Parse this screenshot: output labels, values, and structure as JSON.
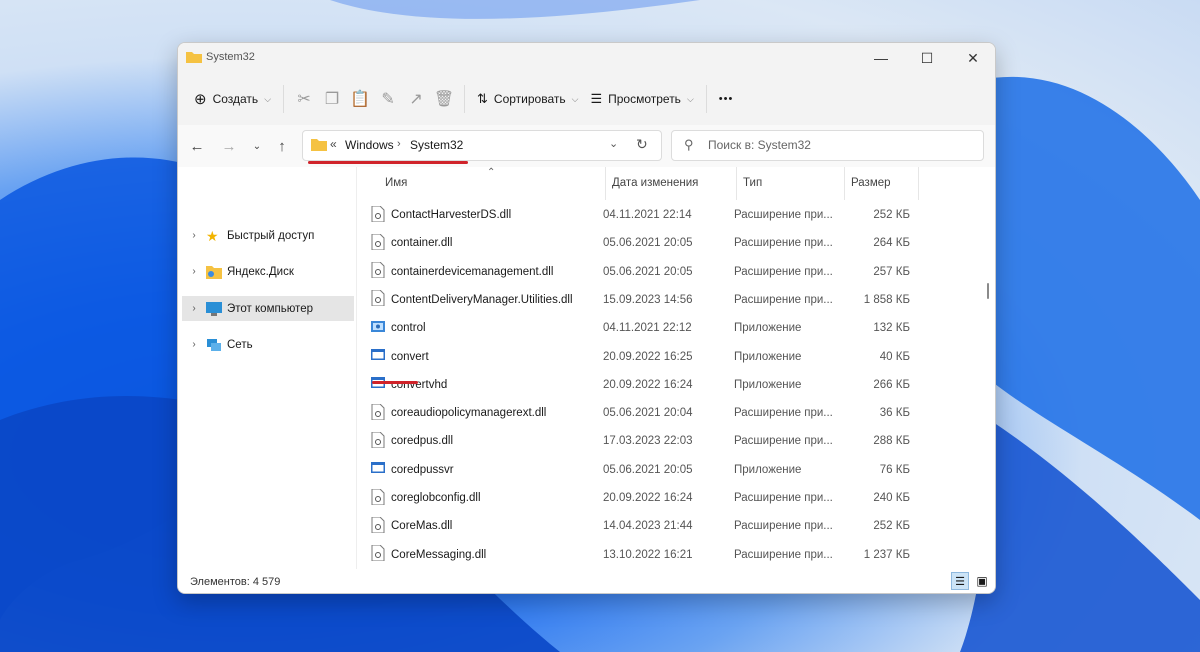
{
  "window": {
    "title": "System32"
  },
  "toolbar": {
    "create_label": "Создать",
    "sort_label": "Сортировать",
    "view_label": "Просмотреть",
    "more_label": "•••"
  },
  "nav": {
    "breadcrumb": [
      "Windows",
      "System32"
    ],
    "breadcrumb_overflow": "«",
    "search_placeholder": "Поиск в: System32"
  },
  "sidebar": {
    "items": [
      {
        "label": "Быстрый доступ",
        "icon": "star-icon",
        "selected": false
      },
      {
        "label": "Яндекс.Диск",
        "icon": "yandex-disk-folder-icon",
        "selected": false
      },
      {
        "label": "Этот компьютер",
        "icon": "computer-icon",
        "selected": true
      },
      {
        "label": "Сеть",
        "icon": "network-icon",
        "selected": false
      }
    ]
  },
  "columns": {
    "name": "Имя",
    "date": "Дата изменения",
    "type": "Тип",
    "size": "Размер"
  },
  "files": [
    {
      "name": "ContactHarvesterDS.dll",
      "date": "04.11.2021 22:14",
      "type": "Расширение при...",
      "size": "252 КБ",
      "icon": "dll-file-icon"
    },
    {
      "name": "container.dll",
      "date": "05.06.2021 20:05",
      "type": "Расширение при...",
      "size": "264 КБ",
      "icon": "dll-file-icon"
    },
    {
      "name": "containerdevicemanagement.dll",
      "date": "05.06.2021 20:05",
      "type": "Расширение при...",
      "size": "257 КБ",
      "icon": "dll-file-icon"
    },
    {
      "name": "ContentDeliveryManager.Utilities.dll",
      "date": "15.09.2023 14:56",
      "type": "Расширение при...",
      "size": "1 858 КБ",
      "icon": "dll-file-icon"
    },
    {
      "name": "control",
      "date": "04.11.2021 22:12",
      "type": "Приложение",
      "size": "132 КБ",
      "icon": "control-panel-app-icon"
    },
    {
      "name": "convert",
      "date": "20.09.2022 16:25",
      "type": "Приложение",
      "size": "40 КБ",
      "icon": "app-icon"
    },
    {
      "name": "convertvhd",
      "date": "20.09.2022 16:24",
      "type": "Приложение",
      "size": "266 КБ",
      "icon": "app-icon"
    },
    {
      "name": "coreaudiopolicymanagerext.dll",
      "date": "05.06.2021 20:04",
      "type": "Расширение при...",
      "size": "36 КБ",
      "icon": "dll-file-icon"
    },
    {
      "name": "coredpus.dll",
      "date": "17.03.2023 22:03",
      "type": "Расширение при...",
      "size": "288 КБ",
      "icon": "dll-file-icon"
    },
    {
      "name": "coredpussvr",
      "date": "05.06.2021 20:05",
      "type": "Приложение",
      "size": "76 КБ",
      "icon": "app-icon"
    },
    {
      "name": "coreglobconfig.dll",
      "date": "20.09.2022 16:24",
      "type": "Расширение при...",
      "size": "240 КБ",
      "icon": "dll-file-icon"
    },
    {
      "name": "CoreMas.dll",
      "date": "14.04.2023 21:44",
      "type": "Расширение при...",
      "size": "252 КБ",
      "icon": "dll-file-icon"
    },
    {
      "name": "CoreMessaging.dll",
      "date": "13.10.2022 16:21",
      "type": "Расширение при...",
      "size": "1 237 КБ",
      "icon": "dll-file-icon"
    }
  ],
  "status": {
    "count_text": "Элементов: 4 579"
  },
  "colors": {
    "accent": "#0067c0",
    "annotation_red": "#d0232a",
    "folder": "#f5c242"
  }
}
